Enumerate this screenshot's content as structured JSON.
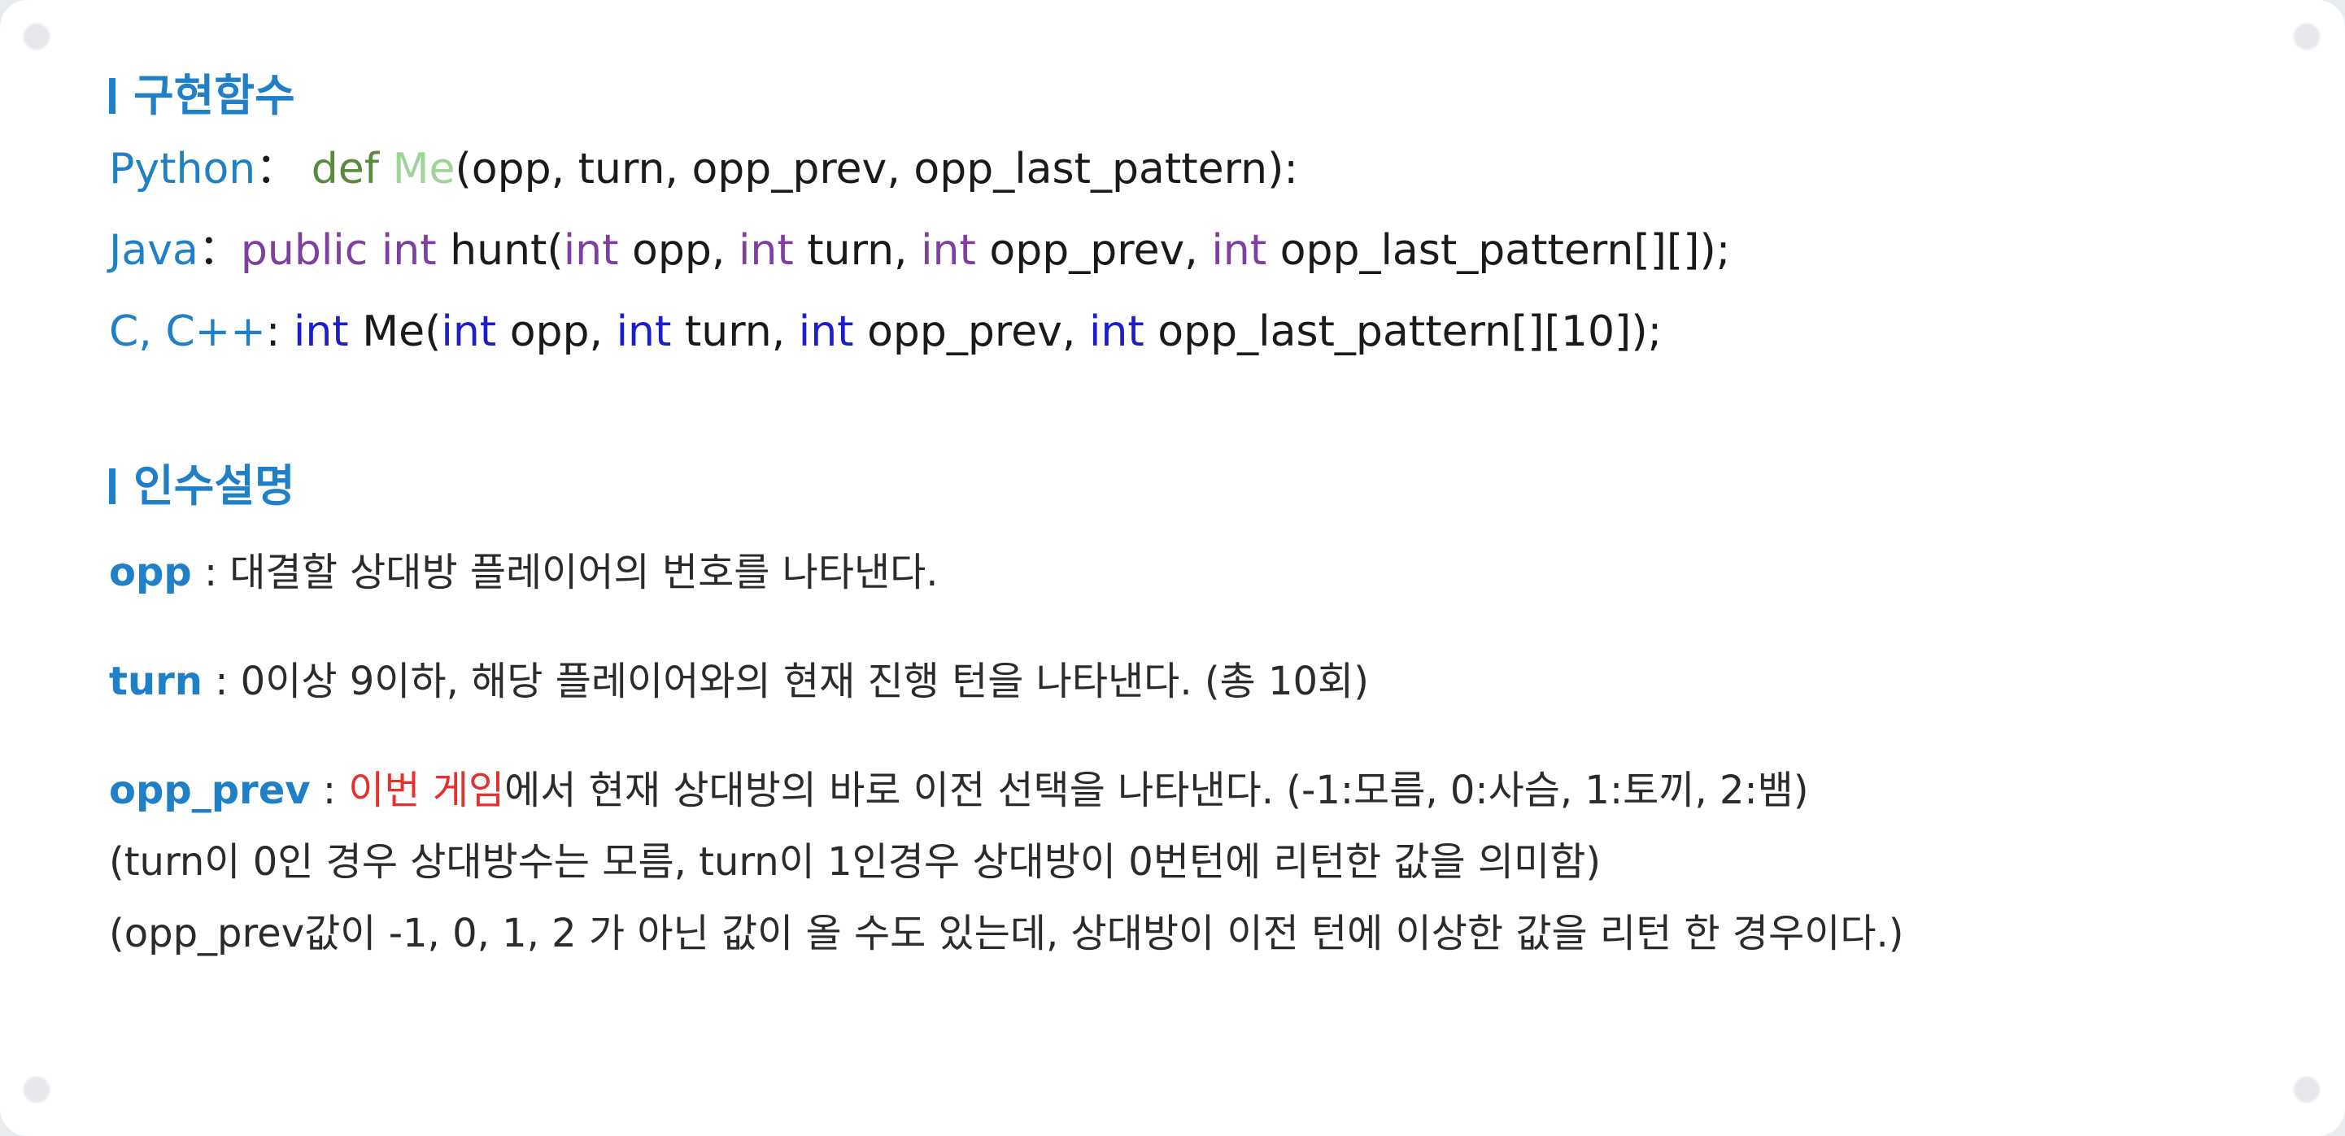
{
  "sections": {
    "impl_title": "구현함수",
    "args_title": "인수설명"
  },
  "code": {
    "python": {
      "lang": "Python",
      "sep": "： ",
      "kw": "def ",
      "fn": "Me",
      "rest": "(opp, turn, opp_prev, opp_last_pattern):"
    },
    "java": {
      "lang": "Java",
      "sep": "：",
      "kw1": "public int",
      "s1": " hunt(",
      "kw2": "int",
      "s2": " opp, ",
      "kw3": "int",
      "s3": " turn, ",
      "kw4": "int",
      "s4": " opp_prev, ",
      "kw5": "int",
      "s5": " opp_last_pattern[][]);"
    },
    "c": {
      "lang": "C, C++",
      "sep": ": ",
      "kw1": "int",
      "s1": " Me(",
      "kw2": "int",
      "s2": " opp, ",
      "kw3": "int",
      "s3": " turn, ",
      "kw4": "int",
      "s4": " opp_prev, ",
      "kw5": "int",
      "s5": " opp_last_pattern[][10]);"
    }
  },
  "args": {
    "opp": {
      "name": "opp",
      "desc": " : 대결할 상대방 플레이어의 번호를 나타낸다."
    },
    "turn": {
      "name": "turn",
      "desc": " : 0이상 9이하, 해당 플레이어와의 현재 진행 턴을 나타낸다. (총 10회)"
    },
    "opp_prev": {
      "name": "opp_prev",
      "sep": " : ",
      "highlight": "이번 게임",
      "desc": "에서 현재 상대방의 바로 이전 선택을 나타낸다. (-1:모름, 0:사슴, 1:토끼, 2:뱀)",
      "note1": "(turn이 0인 경우 상대방수는 모름, turn이 1인경우 상대방이 0번턴에 리턴한 값을 의미함)",
      "note2": "(opp_prev값이 -1, 0, 1, 2 가 아닌 값이 올 수도 있는데, 상대방이 이전 턴에 이상한 값을 리턴 한 경우이다.)"
    }
  },
  "colors": {
    "heading_blue": "#1f80c8",
    "python_keyword": "#5a8a3c",
    "python_function": "#9fd398",
    "java_keyword": "#7e3f9e",
    "c_keyword": "#1d1dcc",
    "highlight_red": "#e53030"
  }
}
